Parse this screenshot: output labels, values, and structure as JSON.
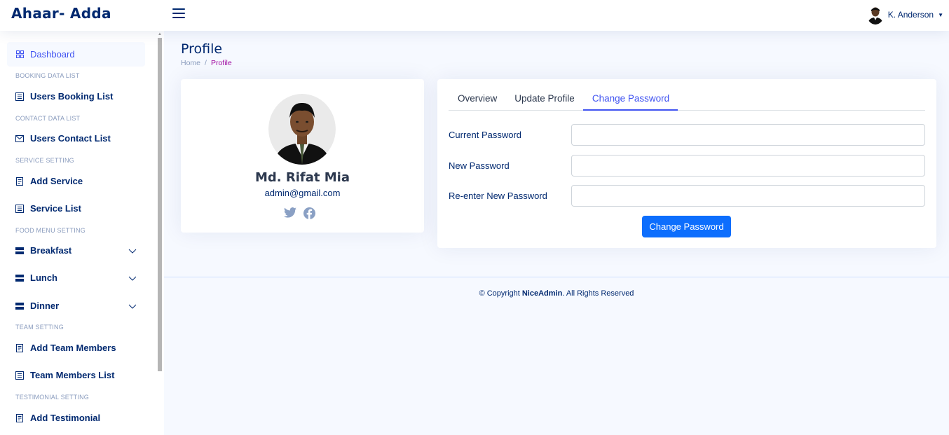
{
  "header": {
    "logo": "Ahaar- Adda",
    "user_name": "K. Anderson"
  },
  "sidebar": {
    "items": [
      {
        "type": "item",
        "label": "Dashboard",
        "icon": "grid-icon",
        "active": true
      },
      {
        "type": "heading",
        "label": "BOOKING DATA LIST"
      },
      {
        "type": "item",
        "label": "Users Booking List",
        "icon": "list-icon"
      },
      {
        "type": "heading",
        "label": "CONTACT DATA LIST"
      },
      {
        "type": "item",
        "label": "Users Contact List",
        "icon": "envelope-icon"
      },
      {
        "type": "heading",
        "label": "SERVICE SETTING"
      },
      {
        "type": "item",
        "label": "Add Service",
        "icon": "form-icon"
      },
      {
        "type": "item",
        "label": "Service List",
        "icon": "list-icon"
      },
      {
        "type": "heading",
        "label": "FOOD MENU SETTING"
      },
      {
        "type": "item",
        "label": "Breakfast",
        "icon": "menu-icon",
        "expandable": true
      },
      {
        "type": "item",
        "label": "Lunch",
        "icon": "menu-icon",
        "expandable": true
      },
      {
        "type": "item",
        "label": "Dinner",
        "icon": "menu-icon",
        "expandable": true
      },
      {
        "type": "heading",
        "label": "TEAM SETTING"
      },
      {
        "type": "item",
        "label": "Add Team Members",
        "icon": "form-icon"
      },
      {
        "type": "item",
        "label": "Team Members List",
        "icon": "list-icon"
      },
      {
        "type": "heading",
        "label": "TESTIMONIAL SETTING"
      },
      {
        "type": "item",
        "label": "Add Testimonial",
        "icon": "form-icon"
      }
    ]
  },
  "page": {
    "title": "Profile",
    "breadcrumb": [
      "Home",
      "Profile"
    ]
  },
  "profile": {
    "name": "Md. Rifat Mia",
    "email": "admin@gmail.com",
    "social": [
      "twitter-icon",
      "facebook-icon"
    ]
  },
  "tabs": [
    "Overview",
    "Update Profile",
    "Change Password"
  ],
  "active_tab": "Change Password",
  "form": {
    "current_password_label": "Current Password",
    "new_password_label": "New Password",
    "reenter_password_label": "Re-enter New Password",
    "submit_label": "Change Password"
  },
  "footer": {
    "prefix": "© Copyright ",
    "brand": "NiceAdmin",
    "suffix": ". All Rights Reserved"
  },
  "colors": {
    "primary": "#4154f1",
    "button": "#0d6efd",
    "text": "#012970",
    "breadcrumb_current": "#a10fa3",
    "background": "#f6f9ff"
  }
}
